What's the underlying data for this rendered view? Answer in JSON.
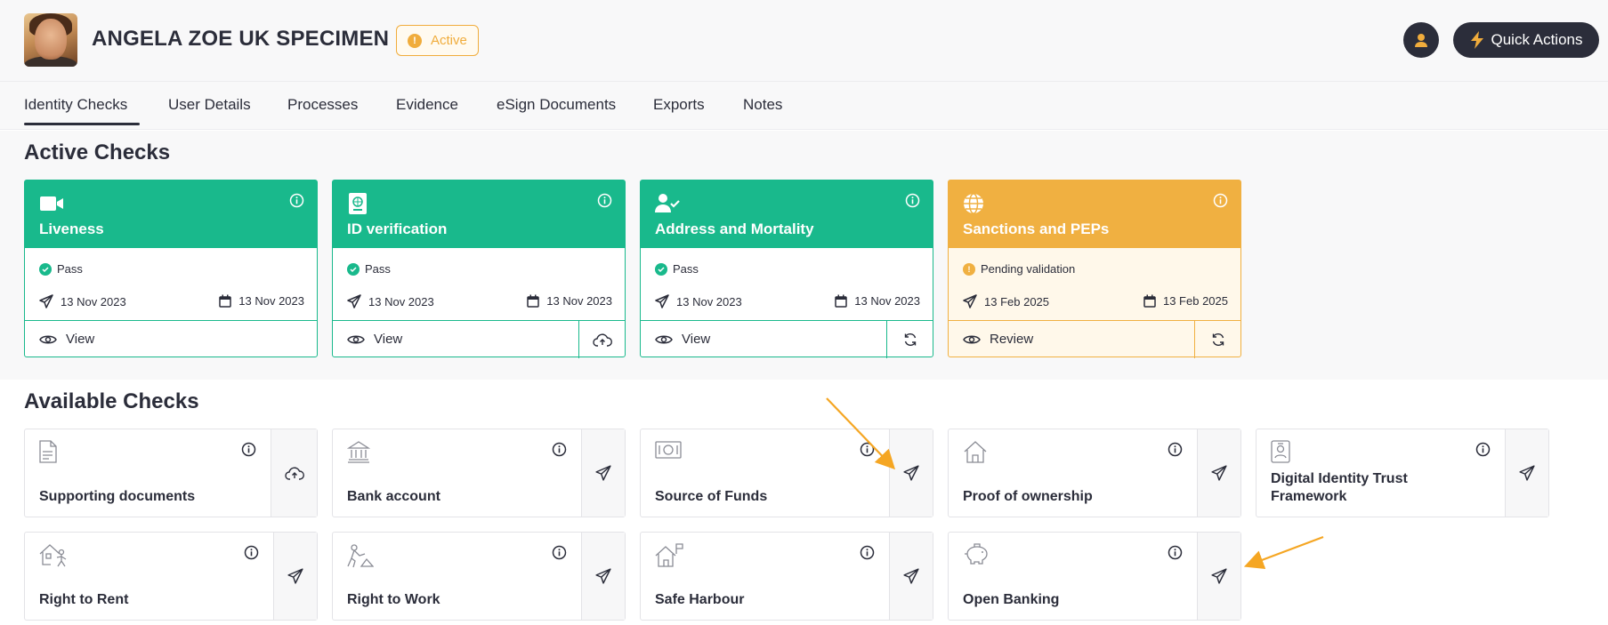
{
  "header": {
    "name": "ANGELA ZOE UK SPECIMEN",
    "status": "Active",
    "quick_actions": "Quick Actions"
  },
  "tabs": [
    {
      "label": "Identity Checks",
      "active": true
    },
    {
      "label": "User Details"
    },
    {
      "label": "Processes"
    },
    {
      "label": "Evidence"
    },
    {
      "label": "eSign Documents"
    },
    {
      "label": "Exports"
    },
    {
      "label": "Notes"
    }
  ],
  "active_checks": {
    "title": "Active Checks",
    "cards": [
      {
        "name": "Liveness",
        "icon": "video-camera-icon",
        "status": "Pass",
        "sent": "13 Nov 2023",
        "due": "13 Nov 2023",
        "action": "View",
        "side_icon": null,
        "color": "#19b98c"
      },
      {
        "name": "ID verification",
        "icon": "passport-icon",
        "status": "Pass",
        "sent": "13 Nov 2023",
        "due": "13 Nov 2023",
        "action": "View",
        "side_icon": "cloud-upload-icon",
        "color": "#19b98c"
      },
      {
        "name": "Address and Mortality",
        "icon": "user-check-icon",
        "status": "Pass",
        "sent": "13 Nov 2023",
        "due": "13 Nov 2023",
        "action": "View",
        "side_icon": "refresh-icon",
        "color": "#19b98c"
      },
      {
        "name": "Sanctions and PEPs",
        "icon": "globe-icon",
        "status": "Pending validation",
        "sent": "13 Feb 2025",
        "due": "13 Feb 2025",
        "action": "Review",
        "side_icon": "refresh-icon",
        "color": "#f0b041"
      }
    ]
  },
  "available_checks": {
    "title": "Available Checks",
    "cards": [
      {
        "name": "Supporting documents",
        "icon": "document-icon",
        "side_icon": "cloud-upload-icon"
      },
      {
        "name": "Bank account",
        "icon": "bank-icon",
        "side_icon": "send-icon"
      },
      {
        "name": "Source of Funds",
        "icon": "cash-icon",
        "side_icon": "send-icon"
      },
      {
        "name": "Proof of ownership",
        "icon": "house-icon",
        "side_icon": "send-icon"
      },
      {
        "name": "Digital Identity Trust Framework",
        "icon": "id-badge-icon",
        "side_icon": "send-icon"
      },
      {
        "name": "Right to Rent",
        "icon": "house-person-icon",
        "side_icon": "send-icon"
      },
      {
        "name": "Right to Work",
        "icon": "worker-icon",
        "side_icon": "send-icon"
      },
      {
        "name": "Safe Harbour",
        "icon": "harbour-flag-icon",
        "side_icon": "send-icon"
      },
      {
        "name": "Open Banking",
        "icon": "piggy-bank-icon",
        "side_icon": "send-icon"
      }
    ]
  },
  "colors": {
    "dark": "#2b2d3a",
    "green": "#19b98c",
    "amber": "#f0b041",
    "annotation": "#f5a623"
  }
}
